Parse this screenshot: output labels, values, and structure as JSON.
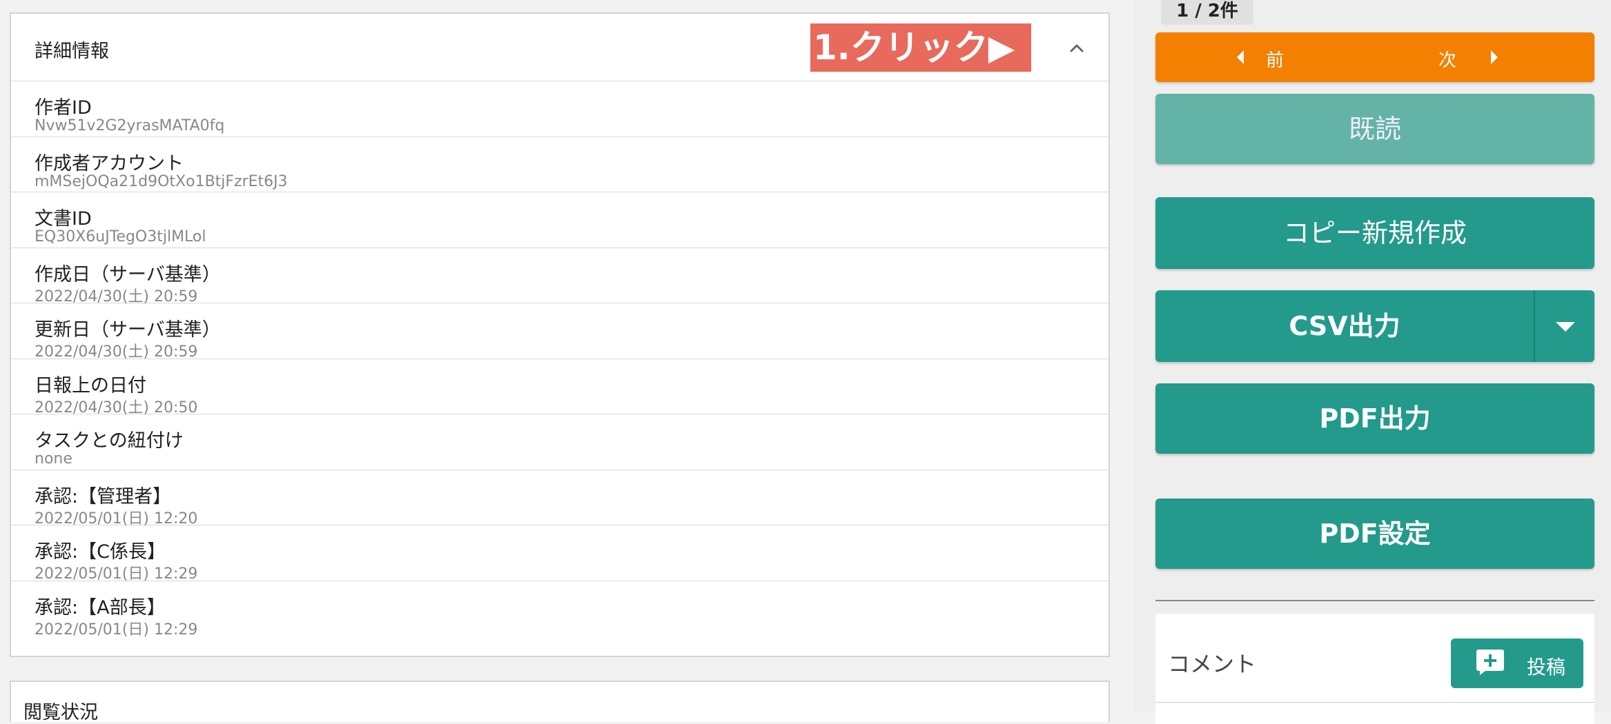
{
  "detail_panel": {
    "title": "詳細情報",
    "annotation": "1.クリック▶",
    "collapse_icon": "chevron-up-icon",
    "rows": [
      {
        "label": "作者ID",
        "value": "Nvw51v2G2yrasMATA0fq"
      },
      {
        "label": "作成者アカウント",
        "value": "mMSejOQa21d9OtXo1BtjFzrEt6J3"
      },
      {
        "label": "文書ID",
        "value": "EQ30X6uJTegO3tjlMLol"
      },
      {
        "label": "作成日（サーバ基準）",
        "value": "2022/04/30(土) 20:59"
      },
      {
        "label": "更新日（サーバ基準）",
        "value": "2022/04/30(土) 20:59"
      },
      {
        "label": "日報上の日付",
        "value": "2022/04/30(土) 20:50"
      },
      {
        "label": "タスクとの紐付け",
        "value": "none"
      },
      {
        "label": "承認:【管理者】",
        "value": "2022/05/01(日) 12:20"
      },
      {
        "label": "承認:【C係長】",
        "value": "2022/05/01(日) 12:29"
      },
      {
        "label": "承認:【A部長】",
        "value": "2022/05/01(日) 12:29"
      }
    ]
  },
  "view_status_panel": {
    "title": "閲覧状況"
  },
  "sidebar": {
    "pager_count": "1 / 2件",
    "nav": {
      "prev_label": "前",
      "next_label": "次"
    },
    "buttons": {
      "read": "既読",
      "copy_new": "コピー新規作成",
      "csv": "CSV出力",
      "pdf": "PDF出力",
      "pdf_settings": "PDF設定"
    },
    "comment": {
      "label": "コメント",
      "post_label": "投稿",
      "post_icon": "plus-comment-icon"
    }
  },
  "colors": {
    "nav_orange": "#f38000",
    "teal": "#239a8b",
    "teal_light": "#64b3a7",
    "annotation_red": "#e86a5c"
  }
}
